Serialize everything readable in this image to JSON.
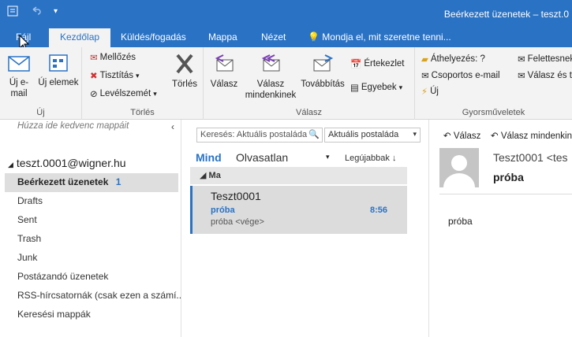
{
  "titlebar": {
    "title": "Beérkezett üzenetek – teszt.0"
  },
  "tabs": [
    "Fájl",
    "Kezdőlap",
    "Küldés/fogadás",
    "Mappa",
    "Nézet"
  ],
  "tell_me": "Mondja el, mit szeretne tenni...",
  "ribbon": {
    "new_email": "Új e-mail",
    "new_items": "Új elemek",
    "group_new": "Új",
    "ignore": "Mellőzés",
    "cleanup": "Tisztítás",
    "junk": "Levélszemét",
    "delete": "Törlés",
    "group_delete": "Törlés",
    "reply": "Válasz",
    "reply_all": "Válasz mindenkinek",
    "forward": "Továbbítás",
    "meeting": "Értekezlet",
    "more": "Egyebek",
    "group_respond": "Válasz",
    "move_to": "Áthelyezés: ?",
    "team_email": "Csoportos e-mail",
    "new_qs": "Új",
    "to_manager": "Felettesnek",
    "reply_delete": "Válasz és t",
    "group_quick": "Gyorsműveletek"
  },
  "nav": {
    "hint": "Húzza ide kedvenc mappáit",
    "account": "teszt.0001@wigner.hu",
    "folders": [
      {
        "name": "Beérkezett üzenetek",
        "count": "1"
      },
      {
        "name": "Drafts"
      },
      {
        "name": "Sent"
      },
      {
        "name": "Trash"
      },
      {
        "name": "Junk"
      },
      {
        "name": "Postázandó üzenetek"
      },
      {
        "name": "RSS-hírcsatornák (csak ezen a számí..."
      },
      {
        "name": "Keresési mappák"
      }
    ]
  },
  "list": {
    "search_placeholder": "Keresés: Aktuális postaláda",
    "scope": "Aktuális postaláda",
    "filter_all": "Mind",
    "filter_unread": "Olvasatlan",
    "sort": "Legújabbak",
    "group": "Ma",
    "message": {
      "from": "Teszt0001",
      "subject": "próba",
      "time": "8:56",
      "preview": "próba <vége>"
    }
  },
  "reading": {
    "reply": "Válasz",
    "reply_all": "Válasz mindenkinek",
    "sender": "Teszt0001 <tes",
    "subject": "próba",
    "body": "próba"
  },
  "colors": {
    "accent": "#2a72c4"
  }
}
